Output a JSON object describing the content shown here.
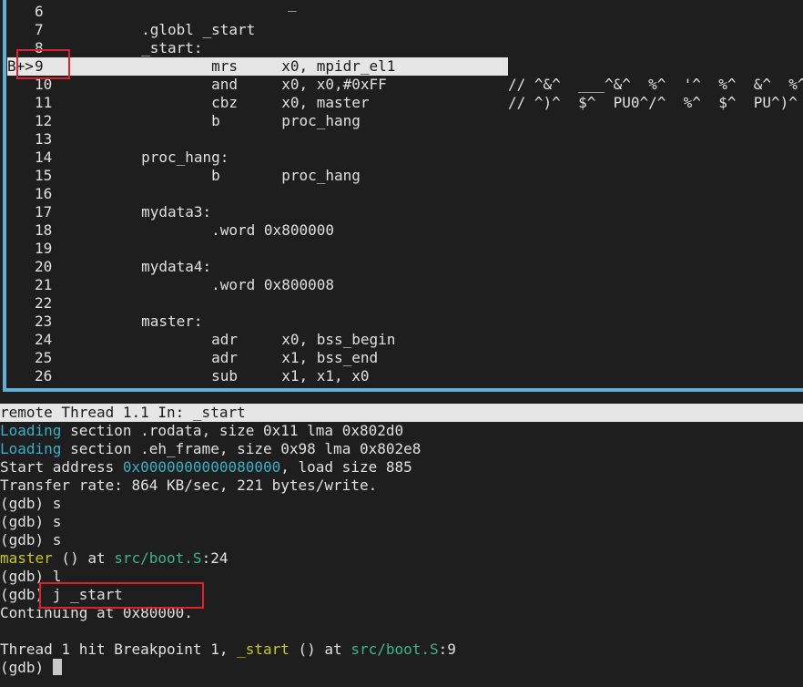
{
  "source_pane": {
    "top_mark": "_",
    "lines": [
      {
        "num": "6",
        "gutter": "",
        "code": "",
        "comment": ""
      },
      {
        "num": "7",
        "gutter": "",
        "code": "        .globl _start",
        "comment": ""
      },
      {
        "num": "8",
        "gutter": "",
        "code": "        _start:",
        "comment": ""
      },
      {
        "num": "9",
        "gutter": "B+>",
        "code": "                mrs     x0, mpidr_el1",
        "comment": ""
      },
      {
        "num": "10",
        "gutter": "",
        "code": "                and     x0, x0,#0xFF",
        "comment": "// ^&^  ___^&^  %^  '^  %^  &^  %^"
      },
      {
        "num": "11",
        "gutter": "",
        "code": "                cbz     x0, master",
        "comment": "// ^)^  $^  PU0^/^  %^  $^  PU^)^"
      },
      {
        "num": "12",
        "gutter": "",
        "code": "                b       proc_hang",
        "comment": ""
      },
      {
        "num": "13",
        "gutter": "",
        "code": "",
        "comment": ""
      },
      {
        "num": "14",
        "gutter": "",
        "code": "        proc_hang:",
        "comment": ""
      },
      {
        "num": "15",
        "gutter": "",
        "code": "                b       proc_hang",
        "comment": ""
      },
      {
        "num": "16",
        "gutter": "",
        "code": "",
        "comment": ""
      },
      {
        "num": "17",
        "gutter": "",
        "code": "        mydata3:",
        "comment": ""
      },
      {
        "num": "18",
        "gutter": "",
        "code": "                .word 0x800000",
        "comment": ""
      },
      {
        "num": "19",
        "gutter": "",
        "code": "",
        "comment": ""
      },
      {
        "num": "20",
        "gutter": "",
        "code": "        mydata4:",
        "comment": ""
      },
      {
        "num": "21",
        "gutter": "",
        "code": "                .word 0x800008",
        "comment": ""
      },
      {
        "num": "22",
        "gutter": "",
        "code": "",
        "comment": ""
      },
      {
        "num": "23",
        "gutter": "",
        "code": "        master:",
        "comment": ""
      },
      {
        "num": "24",
        "gutter": "",
        "code": "                adr     x0, bss_begin",
        "comment": ""
      },
      {
        "num": "25",
        "gutter": "",
        "code": "                adr     x1, bss_end",
        "comment": ""
      },
      {
        "num": "26",
        "gutter": "",
        "code": "                sub     x1, x1, x0",
        "comment": ""
      }
    ]
  },
  "status_bar": {
    "text": "remote Thread 1.1 In: _start"
  },
  "console": {
    "lines": [
      {
        "parts": [
          {
            "t": "Loading",
            "c": "cyan"
          },
          {
            "t": " section .rodata, size 0x11 lma 0x802d0",
            "c": ""
          }
        ]
      },
      {
        "parts": [
          {
            "t": "Loading",
            "c": "cyan"
          },
          {
            "t": " section .eh_frame, size 0x98 lma 0x802e8",
            "c": ""
          }
        ]
      },
      {
        "parts": [
          {
            "t": "Start address ",
            "c": ""
          },
          {
            "t": "0x0000000000080000",
            "c": "cyan"
          },
          {
            "t": ", load size 885",
            "c": ""
          }
        ]
      },
      {
        "parts": [
          {
            "t": "Transfer rate: 864 KB/sec, 221 bytes/write.",
            "c": ""
          }
        ]
      },
      {
        "parts": [
          {
            "t": "(gdb) s",
            "c": ""
          }
        ]
      },
      {
        "parts": [
          {
            "t": "(gdb) s",
            "c": ""
          }
        ]
      },
      {
        "parts": [
          {
            "t": "(gdb) s",
            "c": ""
          }
        ]
      },
      {
        "parts": [
          {
            "t": "master",
            "c": "yellow"
          },
          {
            "t": " () at ",
            "c": ""
          },
          {
            "t": "src/boot.S",
            "c": "green"
          },
          {
            "t": ":24",
            "c": ""
          }
        ]
      },
      {
        "parts": [
          {
            "t": "(gdb) l",
            "c": ""
          }
        ]
      },
      {
        "parts": [
          {
            "t": "(gdb) j _start",
            "c": ""
          }
        ]
      },
      {
        "parts": [
          {
            "t": "Continuing at 0x80000.",
            "c": ""
          }
        ]
      },
      {
        "parts": [
          {
            "t": "",
            "c": ""
          }
        ]
      },
      {
        "parts": [
          {
            "t": "Thread 1 hit Breakpoint 1, ",
            "c": ""
          },
          {
            "t": "_start",
            "c": "yellow"
          },
          {
            "t": " () at ",
            "c": ""
          },
          {
            "t": "src/boot.S",
            "c": "green"
          },
          {
            "t": ":9",
            "c": ""
          }
        ]
      }
    ],
    "prompt": "(gdb) "
  },
  "colors": {
    "background": "#1e1e1e",
    "pane_border": "#5fafd7",
    "highlight_red": "#e0202a",
    "cyan": "#3ab0c8",
    "yellow": "#c8c820",
    "green": "#3cb48c"
  }
}
